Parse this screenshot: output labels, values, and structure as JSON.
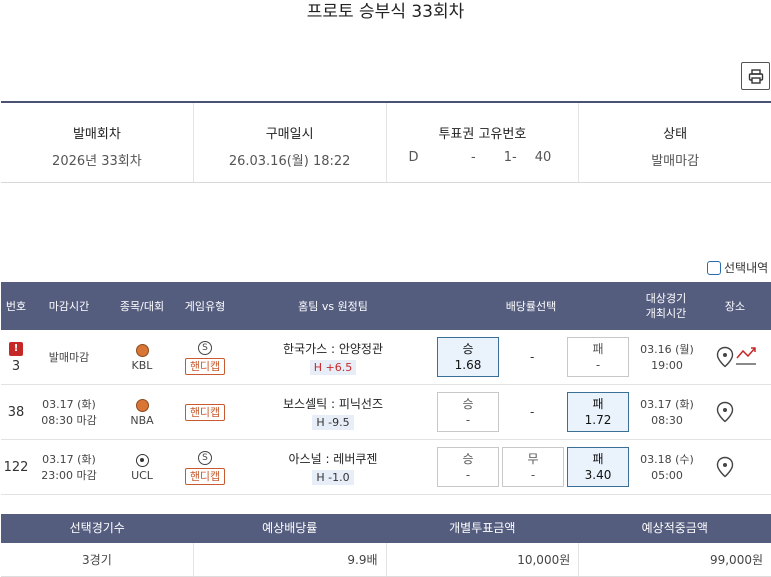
{
  "page": {
    "title": "프로토 승부식 33회차"
  },
  "toolbar": {
    "print_icon": "printer-icon"
  },
  "purchase_info": {
    "round_label": "발매회차",
    "round_value": "2026년 33회차",
    "date_label": "구매일시",
    "date_value": "26.03.16(월) 18:22",
    "ticket_label": "투표권 고유번호",
    "ticket_parts": [
      "D",
      "-",
      "1-",
      "40"
    ],
    "status_label": "상태",
    "status_value": "발매마감"
  },
  "selection_toggle": {
    "label": "선택내역"
  },
  "games_table": {
    "headers": {
      "no": "번호",
      "deadline": "마감시간",
      "sport": "종목/대회",
      "type": "게임유형",
      "teams": "홈팀 vs 원정팀",
      "odds": "배당률선택",
      "date": "대상경기\n개최시간",
      "place": "장소"
    },
    "rows": [
      {
        "no": "3",
        "warning": "!",
        "deadline_line1": "발매마감",
        "deadline_line2": "",
        "league": "KBL",
        "sport_icon": "basketball-icon",
        "special_badge": "S",
        "game_type": "핸디캡",
        "teams": "한국가스 : 안양정관",
        "handicap": "H +6.5",
        "win_label": "승",
        "win_odds": "1.68",
        "draw_text": "-",
        "lose_label": "패",
        "lose_odds": "-",
        "selected": "win",
        "date_line1": "03.16 (월)",
        "date_line2": "19:00",
        "place_icons": [
          "map-pin-icon",
          "trend-chart-icon"
        ]
      },
      {
        "no": "38",
        "warning": "",
        "deadline_line1": "03.17 (화)",
        "deadline_line2": "08:30 마감",
        "league": "NBA",
        "sport_icon": "basketball-icon",
        "special_badge": "",
        "game_type": "핸디캡",
        "teams": "보스셀틱 : 피닉선즈",
        "handicap": "H -9.5",
        "win_label": "승",
        "win_odds": "-",
        "draw_text": "-",
        "lose_label": "패",
        "lose_odds": "1.72",
        "selected": "lose",
        "date_line1": "03.17 (화)",
        "date_line2": "08:30",
        "place_icons": [
          "map-pin-icon"
        ]
      },
      {
        "no": "122",
        "warning": "",
        "deadline_line1": "03.17 (화)",
        "deadline_line2": "23:00 마감",
        "league": "UCL",
        "sport_icon": "soccer-ball-icon",
        "special_badge": "S",
        "game_type": "핸디캡",
        "teams": "아스널 : 레버쿠젠",
        "handicap": "H -1.0",
        "win_label": "승",
        "win_odds": "-",
        "draw_label": "무",
        "draw_odds": "-",
        "lose_label": "패",
        "lose_odds": "3.40",
        "selected": "lose",
        "date_line1": "03.18 (수)",
        "date_line2": "05:00",
        "place_icons": [
          "map-pin-icon"
        ]
      }
    ]
  },
  "summary": {
    "headers": [
      "선택경기수",
      "예상배당률",
      "개별투표금액",
      "예상적중금액"
    ],
    "values": [
      "3경기",
      "9.9배",
      "10,000원",
      "99,000원"
    ]
  },
  "colors": {
    "header_bg": "#555d7f",
    "info_border": "#4a5272",
    "handicap_badge": "#c75a2e",
    "selected_odd_bg": "#eaf3fb",
    "selected_odd_border": "#3a6f98",
    "warning": "#c62828",
    "handicap_plus": "#c62828"
  }
}
